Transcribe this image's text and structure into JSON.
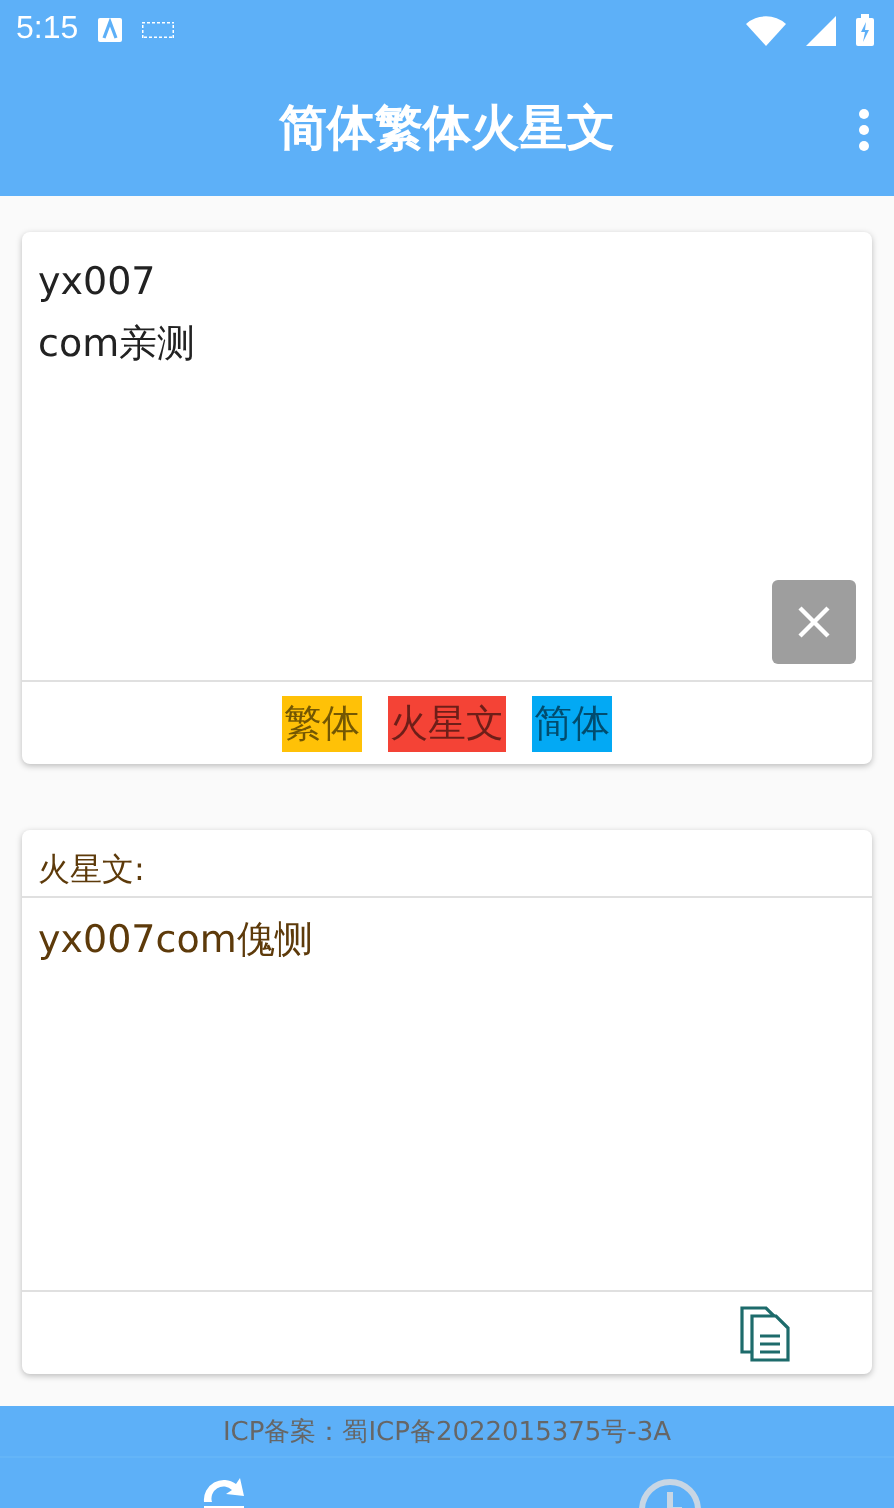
{
  "status_bar": {
    "time": "5:15"
  },
  "app_bar": {
    "title": "简体繁体火星文"
  },
  "input": {
    "value": "yx007\ncom亲测"
  },
  "convert_buttons": [
    {
      "label": "繁体",
      "color": "#ffc107"
    },
    {
      "label": "火星文",
      "color": "#f44336"
    },
    {
      "label": "简体",
      "color": "#03a9f4"
    }
  ],
  "output": {
    "label": "火星文:",
    "value": "yx007com傀恻"
  },
  "footer": {
    "icp": "ICP备案：蜀ICP备2022015375号-3A"
  },
  "bottom_nav": [
    {
      "kind": "convert",
      "selected": true
    },
    {
      "kind": "history",
      "selected": false
    }
  ]
}
